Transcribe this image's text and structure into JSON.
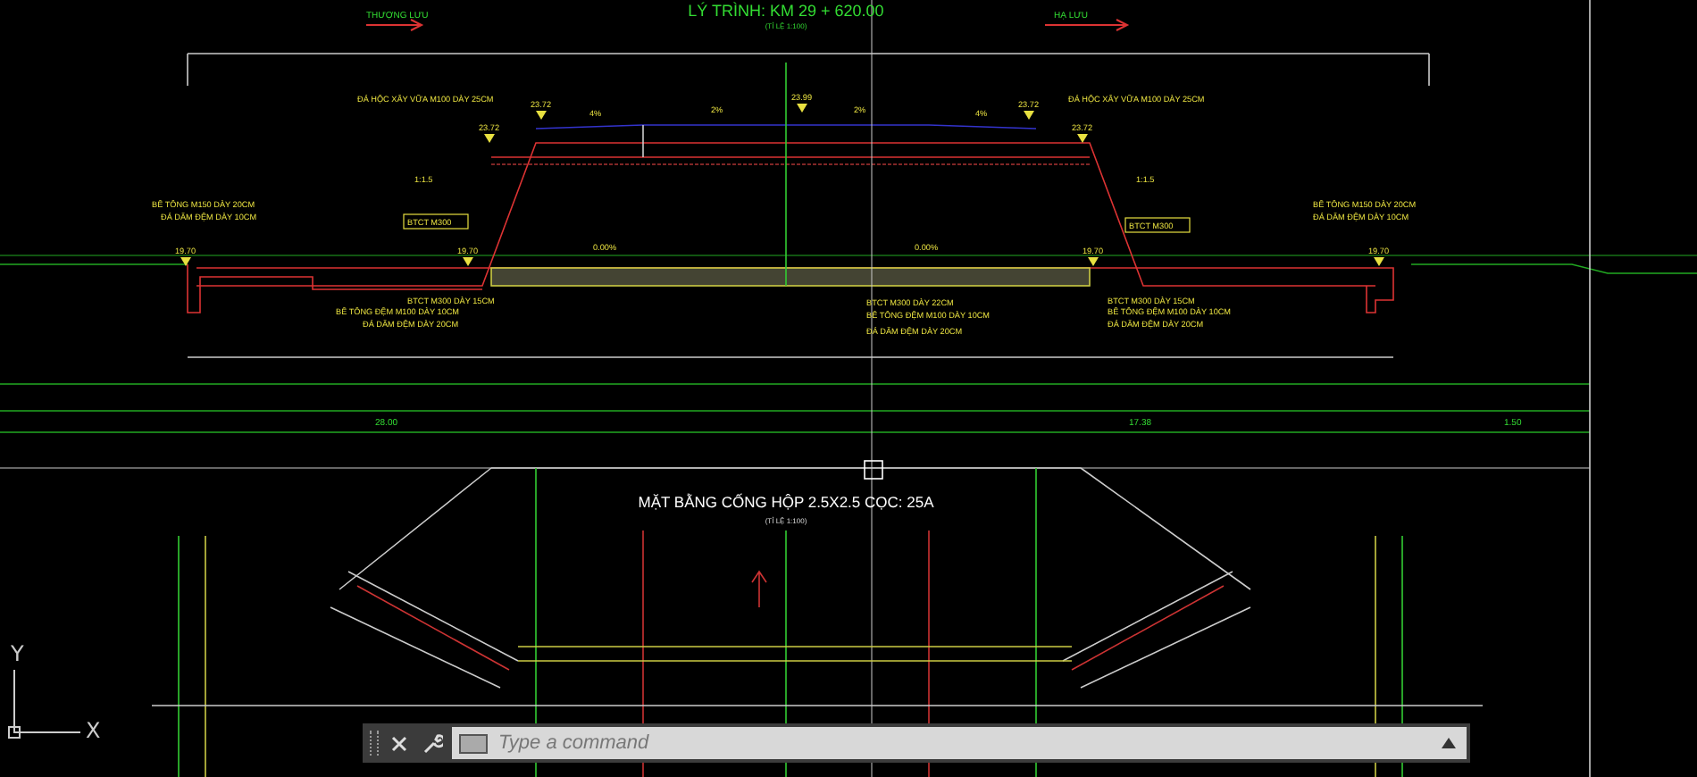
{
  "section": {
    "title": "LÝ TRÌNH: KM 29 + 620.00",
    "scale": "(TỈ LỆ 1:100)",
    "upstream": "THƯỢNG LƯU",
    "downstream": "HẠ LƯU",
    "labels": [
      {
        "text": "ĐÁ HỘC XÂY VỮA M100 DÀY 25CM",
        "kind": "note"
      },
      {
        "text": "ĐÁ HỘC XÂY VỮA M100 DÀY 25CM",
        "kind": "note"
      },
      {
        "text": "23.72",
        "kind": "elevation"
      },
      {
        "text": "23.72",
        "kind": "elevation"
      },
      {
        "text": "23.99",
        "kind": "elevation"
      },
      {
        "text": "23.72",
        "kind": "elevation"
      },
      {
        "text": "23.72",
        "kind": "elevation"
      },
      {
        "text": "4%",
        "kind": "slope"
      },
      {
        "text": "2%",
        "kind": "slope"
      },
      {
        "text": "2%",
        "kind": "slope"
      },
      {
        "text": "4%",
        "kind": "slope"
      },
      {
        "text": "1:1.5",
        "kind": "slope"
      },
      {
        "text": "1:1.5",
        "kind": "slope"
      },
      {
        "text": "BÊ TÔNG M150 DÀY 20CM",
        "kind": "note"
      },
      {
        "text": "ĐÁ DĂM ĐỆM DÀY 10CM",
        "kind": "note"
      },
      {
        "text": "BTCT M300",
        "kind": "tag"
      },
      {
        "text": "19.70",
        "kind": "elevation"
      },
      {
        "text": "19.70",
        "kind": "elevation"
      },
      {
        "text": "0.00%",
        "kind": "slope"
      },
      {
        "text": "BTCT M300 DÀY 15CM",
        "kind": "note"
      },
      {
        "text": "BÊ TÔNG ĐỆM M100 DÀY 10CM",
        "kind": "note"
      },
      {
        "text": "ĐÁ DĂM ĐỆM DÀY 20CM",
        "kind": "note"
      },
      {
        "text": "BTCT M300 DÀY 22CM",
        "kind": "note"
      },
      {
        "text": "BÊ TÔNG ĐỆM M100 DÀY 10CM",
        "kind": "note"
      },
      {
        "text": "ĐÁ DĂM ĐỆM DÀY 20CM",
        "kind": "note"
      },
      {
        "text": "0.00%",
        "kind": "slope"
      },
      {
        "text": "BTCT M300",
        "kind": "tag"
      },
      {
        "text": "19.70",
        "kind": "elevation"
      },
      {
        "text": "BÊ TÔNG M150 DÀY 20CM",
        "kind": "note"
      },
      {
        "text": "ĐÁ DĂM ĐỆM DÀY 10CM",
        "kind": "note"
      },
      {
        "text": "19.70",
        "kind": "elevation"
      },
      {
        "text": "BTCT M300 DÀY 15CM",
        "kind": "note"
      },
      {
        "text": "BÊ TÔNG ĐỆM M100 DÀY 10CM",
        "kind": "note"
      },
      {
        "text": "ĐÁ DĂM ĐỆM DÀY 20CM",
        "kind": "note"
      }
    ]
  },
  "band": [
    {
      "text": "28.00"
    },
    {
      "text": "17.38"
    },
    {
      "text": "1.50"
    }
  ],
  "plan": {
    "title": "MẶT BẰNG CỐNG HỘP 2.5X2.5 CỌC: 25A",
    "scale": "(TỈ LỆ 1:100)"
  },
  "ucs": {
    "y": "Y",
    "x": "X"
  },
  "command_line": {
    "placeholder": "Type a command"
  }
}
